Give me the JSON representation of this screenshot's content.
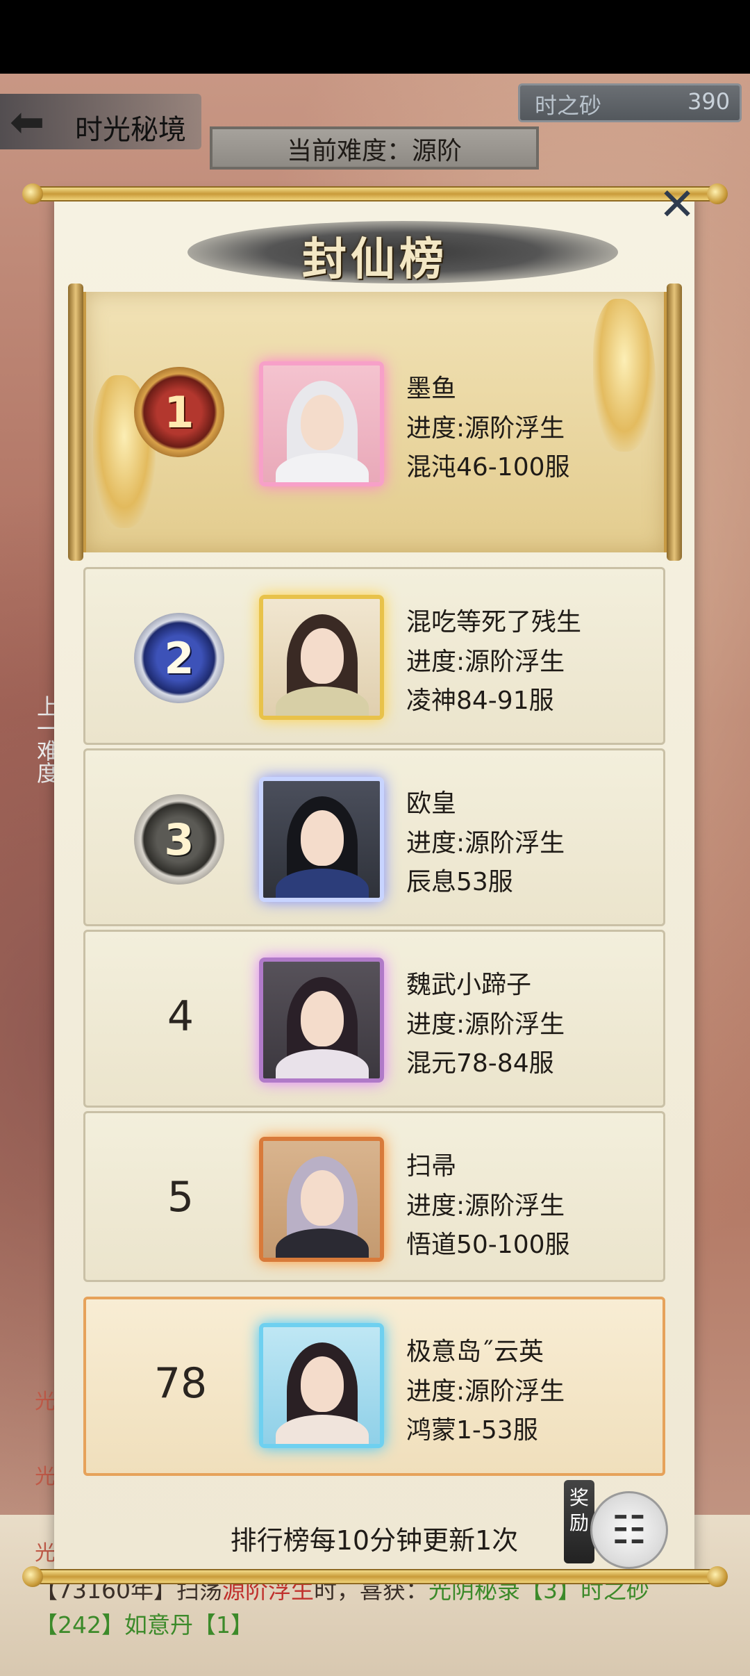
{
  "header": {
    "back_title": "时光秘境",
    "sand_label": "时之砂",
    "sand_value": "390",
    "difficulty": "当前难度：源阶"
  },
  "panel": {
    "title": "封仙榜",
    "footer_note": "排行榜每10分钟更新1次",
    "reward_label": "奖励"
  },
  "rankings": [
    {
      "rank": "1",
      "name": "墨鱼",
      "progress": "进度:源阶浮生",
      "server": "混沌46-100服"
    },
    {
      "rank": "2",
      "name": "混吃等死了残生",
      "progress": "进度:源阶浮生",
      "server": "凌神84-91服"
    },
    {
      "rank": "3",
      "name": "欧皇",
      "progress": "进度:源阶浮生",
      "server": "辰息53服"
    },
    {
      "rank": "4",
      "name": "魏武小蹄子",
      "progress": "进度:源阶浮生",
      "server": "混元78-84服"
    },
    {
      "rank": "5",
      "name": "扫帚",
      "progress": "进度:源阶浮生",
      "server": "悟道50-100服"
    }
  ],
  "self": {
    "rank": "78",
    "name": "极意岛˝云英",
    "progress": "进度:源阶浮生",
    "server": "鸿蒙1-53服"
  },
  "background": {
    "side_nav": "上一难度",
    "log_line1_prefix": "【73160年】扫荡",
    "log_line1_red": "源阶浮生",
    "log_line1_mid": "时，喜获：",
    "log_line1_green": "光阴秘录【3】时之砂",
    "log_line2_green": "【242】如意丹【1】",
    "side_chars": [
      "光",
      "光",
      "光"
    ]
  },
  "colors": {
    "accent_gold": "#c79a44",
    "self_border": "#e6a25a",
    "close_icon": "#2e3b4e"
  }
}
